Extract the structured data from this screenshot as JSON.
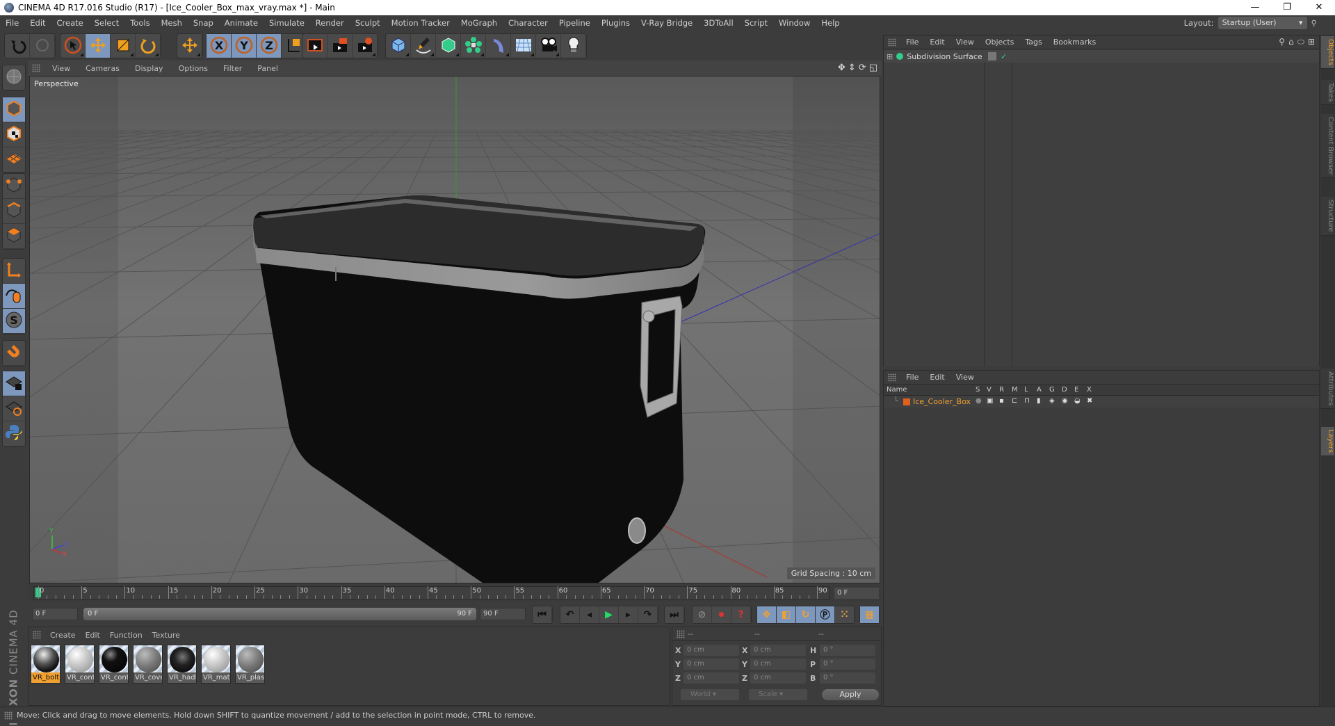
{
  "window": {
    "title": "CINEMA 4D R17.016 Studio (R17) - [Ice_Cooler_Box_max_vray.max *] - Main",
    "minimize": "—",
    "maximize": "❐",
    "close": "✕"
  },
  "menubar": {
    "items": [
      "File",
      "Edit",
      "Create",
      "Select",
      "Tools",
      "Mesh",
      "Snap",
      "Animate",
      "Simulate",
      "Render",
      "Sculpt",
      "Motion Tracker",
      "MoGraph",
      "Character",
      "Pipeline",
      "Plugins",
      "V-Ray Bridge",
      "3DToAll",
      "Script",
      "Window",
      "Help"
    ],
    "layout_label": "Layout:",
    "layout_value": "Startup (User)"
  },
  "toolbar": {
    "groups": [
      [
        "undo-icon",
        "redo-icon"
      ],
      [
        "live-selection-icon",
        "move-icon",
        "scale-icon",
        "rotate-icon"
      ],
      [
        "move-last-icon"
      ],
      [
        "x-axis-lock-icon",
        "y-axis-lock-icon",
        "z-axis-lock-icon",
        "world-coord-icon"
      ],
      [
        "render-view-icon",
        "render-picture-viewer-icon",
        "render-settings-icon"
      ],
      [
        "cube-icon",
        "pen-spline-icon",
        "subdivision-icon",
        "array-icon",
        "deformer-icon",
        "floor-icon",
        "camera-icon",
        "light-icon"
      ]
    ]
  },
  "left_tools": [
    "make-editable-icon",
    "model-mode-icon",
    "texture-mode-icon",
    "workplane-icon",
    "points-mode-icon",
    "edges-mode-icon",
    "polygons-mode-icon",
    "axis-mode-icon",
    "tweak-mode-icon",
    "solo-icon",
    "snap-icon",
    "locked-workplane-icon",
    "planar-workplane-icon",
    "python-icon"
  ],
  "viewport": {
    "menu": [
      "View",
      "Cameras",
      "Display",
      "Options",
      "Filter",
      "Panel"
    ],
    "label": "Perspective",
    "grid_spacing": "Grid Spacing : 10 cm",
    "axis": {
      "x": "X",
      "y": "Y",
      "z": "Z"
    },
    "colors": {
      "x_axis": "#c03030",
      "y_axis": "#30a030",
      "z_axis": "#3030c0",
      "background": "#636363"
    }
  },
  "timeline": {
    "ticks": [
      "0",
      "5",
      "10",
      "15",
      "20",
      "25",
      "30",
      "35",
      "40",
      "45",
      "50",
      "55",
      "60",
      "65",
      "70",
      "75",
      "80",
      "85",
      "90"
    ],
    "current_frame": "0 F",
    "start_field": "0 F",
    "range_start": "0 F",
    "range_end": "90 F",
    "end_field": "90 F",
    "current_value": 0,
    "max_value": 90
  },
  "transport": {
    "buttons": [
      "⏮",
      "↺",
      "◀",
      "▶",
      "▶|",
      "↻",
      "⏭"
    ],
    "keys": [
      "record-key-icon",
      "autokey-icon",
      "keyframe-help-icon"
    ],
    "key_modes": [
      "key-position-icon",
      "key-scale-icon",
      "key-rotation-icon",
      "key-param-icon",
      "key-pla-icon"
    ]
  },
  "materials": {
    "menu": [
      "Create",
      "Edit",
      "Function",
      "Texture"
    ],
    "items": [
      {
        "name": "VR_bolt",
        "selected": true,
        "style": "chrome"
      },
      {
        "name": "VR_cont",
        "selected": false,
        "style": "white"
      },
      {
        "name": "VR_cont",
        "selected": false,
        "style": "black"
      },
      {
        "name": "VR_cove",
        "selected": false,
        "style": "gray"
      },
      {
        "name": "VR_hadl",
        "selected": false,
        "style": "darkspeck"
      },
      {
        "name": "VR_mat_",
        "selected": false,
        "style": "white"
      },
      {
        "name": "VR_plas",
        "selected": false,
        "style": "gray"
      }
    ]
  },
  "brand": {
    "maxon": "MAXON",
    "product": "CINEMA 4D"
  },
  "coordinates": {
    "headers": [
      "--",
      "--",
      "--"
    ],
    "rows": [
      {
        "a": "X",
        "a_val": "0 cm",
        "b": "X",
        "b_val": "0 cm",
        "c": "H",
        "c_val": "0 °"
      },
      {
        "a": "Y",
        "a_val": "0 cm",
        "b": "Y",
        "b_val": "0 cm",
        "c": "P",
        "c_val": "0 °"
      },
      {
        "a": "Z",
        "a_val": "0 cm",
        "b": "Z",
        "b_val": "0 cm",
        "c": "B",
        "c_val": "0 °"
      }
    ],
    "coord_system": "World",
    "mode": "Scale",
    "apply": "Apply"
  },
  "status": "Move: Click and drag to move elements. Hold down SHIFT to quantize movement / add to the selection in point mode, CTRL to remove.",
  "objects_panel": {
    "menu": [
      "File",
      "Edit",
      "View",
      "Objects",
      "Tags",
      "Bookmarks"
    ],
    "objects": [
      {
        "name": "Subdivision Surface",
        "expanded": false
      }
    ]
  },
  "layers_panel": {
    "menu": [
      "File",
      "Edit",
      "View"
    ],
    "columns": [
      "Name",
      "S",
      "V",
      "R",
      "M",
      "L",
      "A",
      "G",
      "D",
      "E",
      "X"
    ],
    "layers": [
      {
        "name": "Ice_Cooler_Box",
        "color": "#e06020"
      }
    ]
  },
  "right_tabs": {
    "top": [
      {
        "label": "Objects",
        "active": true
      },
      {
        "label": "Takes",
        "active": false
      },
      {
        "label": "Content Browser",
        "active": false
      },
      {
        "label": "Structure",
        "active": false
      }
    ],
    "bottom": [
      {
        "label": "Attributes",
        "active": false
      },
      {
        "label": "Layers",
        "active": true
      }
    ]
  }
}
